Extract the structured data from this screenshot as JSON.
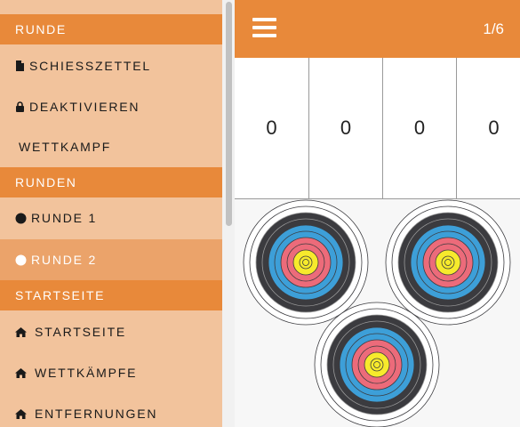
{
  "sidebar": {
    "sections": [
      {
        "header": "RUNDE",
        "items": [
          {
            "label": "SCHIESSZETTEL",
            "icon": "file-icon"
          },
          {
            "label": "DEAKTIVIEREN",
            "icon": "lock-icon"
          },
          {
            "label": "WETTKAMPF",
            "icon": ""
          }
        ]
      },
      {
        "header": "RUNDEN",
        "items": [
          {
            "label": "RUNDE 1",
            "icon": "circle-filled-icon"
          },
          {
            "label": "RUNDE 2",
            "icon": "circle-white-icon",
            "active": true
          }
        ]
      },
      {
        "header": "STARTSEITE",
        "items": [
          {
            "label": "STARTSEITE",
            "icon": "home-icon"
          },
          {
            "label": "WETTKÄMPFE",
            "icon": "home-icon"
          },
          {
            "label": "ENTFERNUNGEN",
            "icon": "home-icon"
          }
        ]
      }
    ]
  },
  "topbar": {
    "menu_icon": "hamburger-icon",
    "counter": "1/6"
  },
  "scores": [
    "0",
    "0",
    "0",
    "0"
  ],
  "colors": {
    "accent": "#e8893a",
    "sidebar_bg": "#f2c39c",
    "active_item": "#eba36a",
    "ring_black": "#3b3b3f",
    "ring_blue": "#3d9fd8",
    "ring_red": "#ec6b7a",
    "ring_gold": "#f7ea2c"
  }
}
